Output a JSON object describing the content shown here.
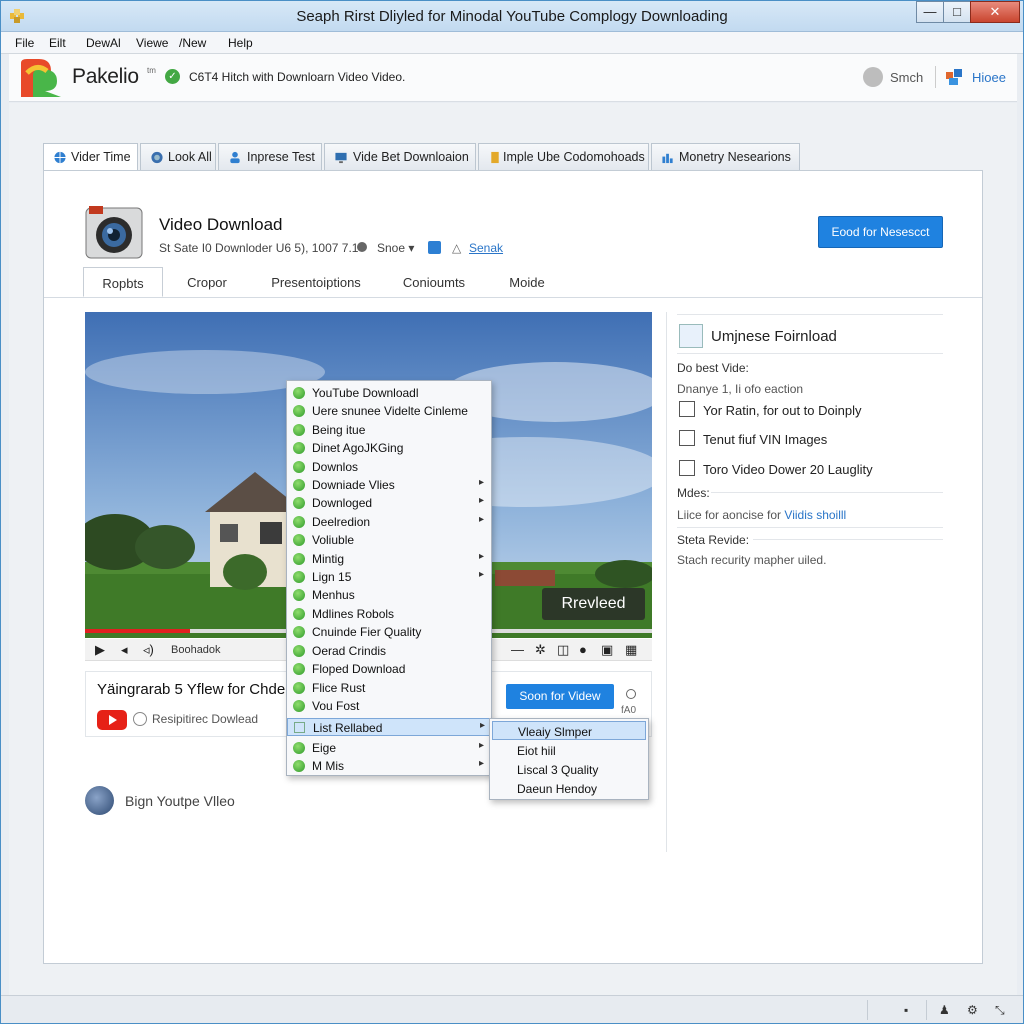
{
  "window": {
    "title": "Seaph Rirst Dliyled for Minodal YouTube Complogy Downloading",
    "minimize": "—",
    "maximize": "□",
    "close": "✕"
  },
  "menubar": [
    "File",
    "Eilt",
    "DewAl",
    "Viewe",
    "/New",
    "Help"
  ],
  "toolbar": {
    "brand": "Pakelio",
    "brand_tm": "tm",
    "status_text": "C6T4 Hitch with Downloarn Video Video.",
    "search_label": "Smch",
    "home_label": "Hioee"
  },
  "tabs": [
    "Vider Time",
    "Look All",
    "Inprese Test",
    "Vide Bet Downloaion",
    "Imple Ube Codomohoads",
    "Monetry Nesearions"
  ],
  "header": {
    "title": "Video Download",
    "subtitle": "St Sate I0 Downloder U6 5), 1007 7.1",
    "share": "Snoe",
    "link": "Senak",
    "cta": "Eood for Nesescct"
  },
  "subtabs": [
    "Ropbts",
    "Cropor",
    "Presentoiptions",
    "Conioumts",
    "Moide"
  ],
  "player": {
    "replay_label": "Rrevleed",
    "controls_label": "Boohadok",
    "progress": 0.185
  },
  "info": {
    "title": "Yäingrarab 5 Yflew for Chdep",
    "download_label": "Resipitirec Dowlead",
    "watch_button": "Soon for Videw",
    "tag": "fA0"
  },
  "footer": {
    "label": "Bign Youtpe Vlleo"
  },
  "sidebar": {
    "title": "Umjnese Foirnload",
    "best_label": "Do best Vide:",
    "best_sub": "Dnanye 1, Ii ofo eaction",
    "checkboxes": [
      "Yor Ratin, for out to Doinply",
      "Tenut fiuf VIN Images",
      "Toro Video Dower 20 Lauglity"
    ],
    "notes_label": "Mdes:",
    "notes_text": "Liice for aoncise for",
    "notes_link": "Viidis shoilll",
    "review_label": "Steta Revide:",
    "review_text": "Stach recurity mapher uiled."
  },
  "context_menu": {
    "items": [
      {
        "label": "YouTube Downloadl",
        "submenu": false
      },
      {
        "label": "Uere snunee Videlte Cinleme",
        "submenu": false
      },
      {
        "label": "Being itue",
        "submenu": false
      },
      {
        "label": "Dinet AgoJKGing",
        "submenu": false
      },
      {
        "label": "Downlos",
        "submenu": false
      },
      {
        "label": "Downiade Vlies",
        "submenu": true
      },
      {
        "label": "Downloged",
        "submenu": true
      },
      {
        "label": "Deelredion",
        "submenu": true
      },
      {
        "label": "Voliuble",
        "submenu": false
      },
      {
        "label": "Mintig",
        "submenu": true
      },
      {
        "label": "Lign 15",
        "submenu": true
      },
      {
        "label": "Menhus",
        "submenu": false
      },
      {
        "label": "Mdlines Robols",
        "submenu": false
      },
      {
        "label": "Cnuinde Fier Quality",
        "submenu": false
      },
      {
        "label": "Oerad Crindis",
        "submenu": false
      },
      {
        "label": "Floped Download",
        "submenu": false
      },
      {
        "label": "Flice Rust",
        "submenu": false
      },
      {
        "label": "Vou Fost",
        "submenu": false
      },
      {
        "label": "List Rellabed",
        "submenu": true,
        "highlighted": true
      },
      {
        "label": "Eige",
        "submenu": true
      },
      {
        "label": "M Mis",
        "submenu": true
      }
    ]
  },
  "submenu": {
    "items": [
      "Vleaiy Slmper",
      "Eiot hiil",
      "Liscal 3 Quality",
      "Daeun Hendoy"
    ]
  },
  "colors": {
    "accent": "#1f82e0",
    "menu_highlight": "#cfe4fa",
    "menu_icon": "#2f9a2b",
    "youtube": "#e62117"
  }
}
